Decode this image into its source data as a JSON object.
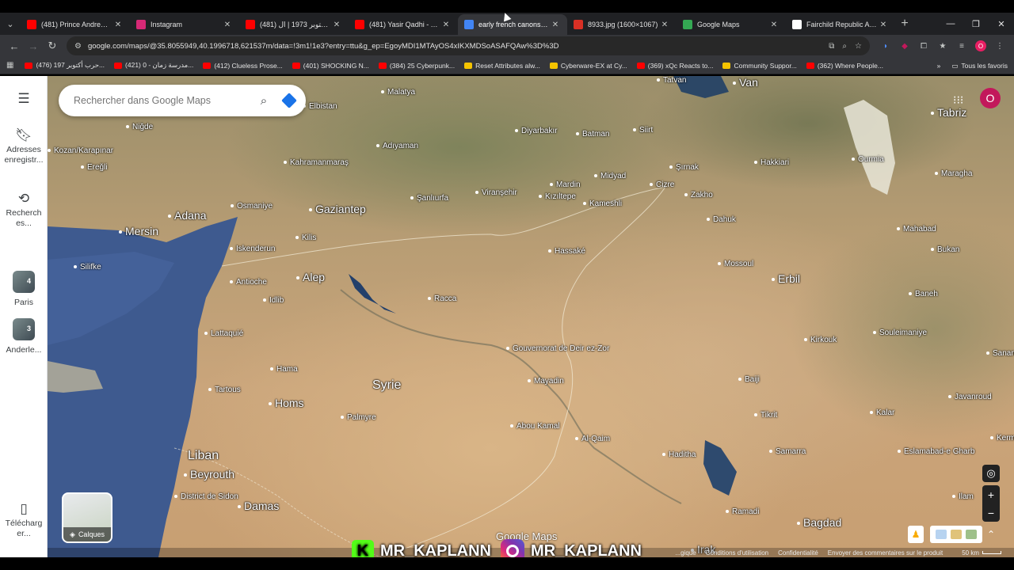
{
  "browser": {
    "tabs": [
      {
        "title": "(481) Prince Andrew & th",
        "favicon_color": "#ff0000",
        "active": false
      },
      {
        "title": "Instagram",
        "favicon_color": "#d62976",
        "active": false
      },
      {
        "title": "(481) حرب أكتوبر 1973 | ال...",
        "favicon_color": "#ff0000",
        "active": false
      },
      {
        "title": "(481) Yasir Qadhi - YouTu",
        "favicon_color": "#ff0000",
        "active": false
      },
      {
        "title": "early french canons - Goo",
        "favicon_color": "#4285f4",
        "active": true
      },
      {
        "title": "8933.jpg (1600×1067)",
        "favicon_color": "#d93025",
        "active": false
      },
      {
        "title": "Google Maps",
        "favicon_color": "#34a853",
        "active": false
      },
      {
        "title": "Fairchild Republic A-10 Th",
        "favicon_color": "#ffffff",
        "active": false
      }
    ],
    "url": "google.com/maps/@35.8055949,40.1996718,621537m/data=!3m1!1e3?entry=ttu&g_ep=EgoyMDI1MTAyOS4xIKXMDSoASAFQAw%3D%3D",
    "bookmarks": [
      {
        "label": "(476) حرب أكتوبر 197...",
        "color": "#ff0000"
      },
      {
        "label": "(421) مدرسة زمان - 0...",
        "color": "#ff0000"
      },
      {
        "label": "(412) Clueless Prose...",
        "color": "#ff0000"
      },
      {
        "label": "(401) SHOCKING N...",
        "color": "#ff0000"
      },
      {
        "label": "(384) 25 Cyberpunk...",
        "color": "#ff0000"
      },
      {
        "label": "Reset Attributes alw...",
        "color": "#f5c400"
      },
      {
        "label": "Cyberware-EX at Cy...",
        "color": "#f5c400"
      },
      {
        "label": "(369) xQc Reacts to...",
        "color": "#ff0000"
      },
      {
        "label": "Community Suppor...",
        "color": "#f5c400"
      },
      {
        "label": "(362) Where People...",
        "color": "#ff0000"
      }
    ],
    "all_bookmarks": "Tous les favoris",
    "overflow": "»",
    "profile_initial": "O"
  },
  "rail": {
    "saved": "Adresses enregistr...",
    "recent": "Recherch es...",
    "recent_1": {
      "label": "Paris",
      "count": "4"
    },
    "recent_2": {
      "label": "Anderle...",
      "count": "3"
    },
    "download": "Télécharg er..."
  },
  "search": {
    "placeholder": "Rechercher dans Google Maps"
  },
  "map": {
    "avatar": "O",
    "layers_label": "Calques",
    "logo": "Google Maps",
    "footer": {
      "attribution": "...gique",
      "terms": "Conditions d'utilisation",
      "privacy": "Confidentialité",
      "feedback": "Envoyer des commentaires sur le produit",
      "scale": "50 km"
    },
    "places": [
      {
        "name": "Malatya"
      },
      {
        "name": "Tatvan"
      },
      {
        "name": "Van"
      },
      {
        "name": "Elbistan"
      },
      {
        "name": "Niğde"
      },
      {
        "name": "Kahramanmaraş"
      },
      {
        "name": "Adıyaman"
      },
      {
        "name": "Diyarbakır"
      },
      {
        "name": "Batman"
      },
      {
        "name": "Siirt"
      },
      {
        "name": "Kozan/Karapınar"
      },
      {
        "name": "Ereğli"
      },
      {
        "name": "Adana"
      },
      {
        "name": "Osmaniye"
      },
      {
        "name": "Gaziantep"
      },
      {
        "name": "Şanlıurfa"
      },
      {
        "name": "Viranşehir"
      },
      {
        "name": "Mardin"
      },
      {
        "name": "Kızıltepe"
      },
      {
        "name": "Midyad"
      },
      {
        "name": "Şırnak"
      },
      {
        "name": "Hakkiari"
      },
      {
        "name": "Cizre"
      },
      {
        "name": "Zakho"
      },
      {
        "name": "Mersin"
      },
      {
        "name": "Kilis"
      },
      {
        "name": "Kameshli"
      },
      {
        "name": "Dahuk"
      },
      {
        "name": "Iskenderun"
      },
      {
        "name": "Silifke"
      },
      {
        "name": "Antioche"
      },
      {
        "name": "Alep"
      },
      {
        "name": "Hassaké"
      },
      {
        "name": "Mossoul"
      },
      {
        "name": "Erbil"
      },
      {
        "name": "Idlib"
      },
      {
        "name": "Racca"
      },
      {
        "name": "Lattaquié"
      },
      {
        "name": "Kirkouk"
      },
      {
        "name": "Souleimaniye"
      },
      {
        "name": "Gouvernorat de Deir ez-Zor"
      },
      {
        "name": "Hama"
      },
      {
        "name": "Mayadin"
      },
      {
        "name": "Baiji"
      },
      {
        "name": "Tartous"
      },
      {
        "name": "Syrie"
      },
      {
        "name": "Homs"
      },
      {
        "name": "Palmyre"
      },
      {
        "name": "Tikrit"
      },
      {
        "name": "Abou Kamal"
      },
      {
        "name": "Al-Qaim"
      },
      {
        "name": "Haditha"
      },
      {
        "name": "Samarra"
      },
      {
        "name": "Liban"
      },
      {
        "name": "Beyrouth"
      },
      {
        "name": "District de Sidon"
      },
      {
        "name": "Damas"
      },
      {
        "name": "Ramadi"
      },
      {
        "name": "Bagdad"
      },
      {
        "name": "Tabriz"
      },
      {
        "name": "Ourmia"
      },
      {
        "name": "Maragha"
      },
      {
        "name": "Mahabad"
      },
      {
        "name": "Bukan"
      },
      {
        "name": "Baneh"
      },
      {
        "name": "Sanand"
      },
      {
        "name": "Javanroud"
      },
      {
        "name": "Kalar"
      },
      {
        "name": "Eslamabad-e Gharb"
      },
      {
        "name": "Kerma"
      },
      {
        "name": "Ilam"
      },
      {
        "name": "Irak"
      }
    ]
  },
  "watermark": {
    "kick_handle": "MR_KAPLANN",
    "kick_letter": "K",
    "instagram_handle": "MR_KAPLANN"
  }
}
